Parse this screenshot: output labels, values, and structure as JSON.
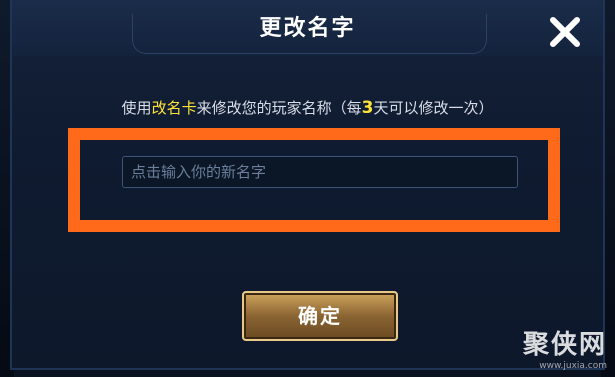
{
  "dialog": {
    "title": "更改名字",
    "instruction": {
      "prefix": "使用",
      "card": "改名卡",
      "mid": "来修改您的玩家名称（每",
      "days": "3",
      "suffix": "天可以修改一次）"
    },
    "name_input": {
      "placeholder": "点击输入你的新名字",
      "value": ""
    },
    "confirm_label": "确定",
    "close_icon": "close-x-icon"
  },
  "watermark": {
    "logo": "聚侠网",
    "url": "www.juxia.com"
  },
  "colors": {
    "highlight": "#ffe33a",
    "annotation_box": "#ff6a1a",
    "button_gold": "#cfa45d"
  }
}
